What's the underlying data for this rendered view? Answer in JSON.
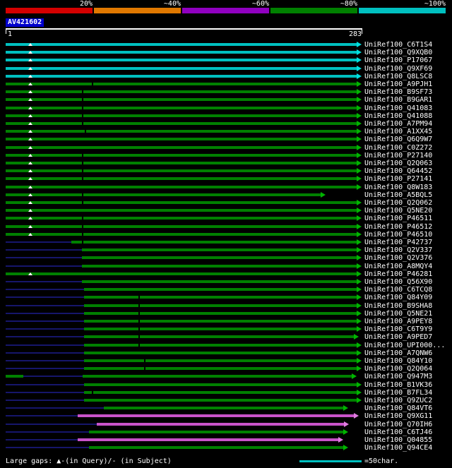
{
  "scale": {
    "segments": [
      {
        "label": "20%",
        "color": "#d40000"
      },
      {
        "label": "~40%",
        "color": "#e07800"
      },
      {
        "label": "~60%",
        "color": "#9000c0"
      },
      {
        "label": "~80%",
        "color": "#008000"
      },
      {
        "label": "~100%",
        "color": "#00c0c0"
      }
    ]
  },
  "query": {
    "name": "AV421602",
    "start_label": "1",
    "end_label": "283",
    "length": 283
  },
  "colors": {
    "cyan": "#00c0c0",
    "green": "#008000",
    "magenta": "#c853c8",
    "line": "#16166b",
    "arrow_cyan": "#00e0e0",
    "arrow_green": "#00b400",
    "arrow_magenta": "#e07ce0"
  },
  "rows": [
    {
      "label": "UniRef100_C6T1S4",
      "color": "cyan",
      "line": null,
      "bars": [
        [
          1,
          283
        ]
      ],
      "query_gaps": [
        21
      ],
      "subject_gaps": []
    },
    {
      "label": "UniRef100_Q9XQB0",
      "color": "cyan",
      "line": null,
      "bars": [
        [
          1,
          283
        ]
      ],
      "query_gaps": [
        21
      ],
      "subject_gaps": []
    },
    {
      "label": "UniRef100_P17067",
      "color": "cyan",
      "line": null,
      "bars": [
        [
          1,
          283
        ]
      ],
      "query_gaps": [
        21
      ],
      "subject_gaps": []
    },
    {
      "label": "UniRef100_Q9XF69",
      "color": "cyan",
      "line": null,
      "bars": [
        [
          1,
          283
        ]
      ],
      "query_gaps": [
        21
      ],
      "subject_gaps": []
    },
    {
      "label": "UniRef100_Q8LSC8",
      "color": "cyan",
      "line": null,
      "bars": [
        [
          1,
          283
        ]
      ],
      "query_gaps": [
        21
      ],
      "subject_gaps": []
    },
    {
      "label": "UniRef100_A9PJH1",
      "color": "green",
      "line": null,
      "bars": [
        [
          1,
          283
        ]
      ],
      "query_gaps": [
        21
      ],
      "subject_gaps": [
        71
      ]
    },
    {
      "label": "UniRef100_B9SF73",
      "color": "green",
      "line": null,
      "bars": [
        [
          1,
          283
        ]
      ],
      "query_gaps": [
        21
      ],
      "subject_gaps": [
        63
      ]
    },
    {
      "label": "UniRef100_B9GAR1",
      "color": "green",
      "line": null,
      "bars": [
        [
          1,
          283
        ]
      ],
      "query_gaps": [
        21
      ],
      "subject_gaps": [
        63
      ]
    },
    {
      "label": "UniRef100_Q41083",
      "color": "green",
      "line": null,
      "bars": [
        [
          1,
          283
        ]
      ],
      "query_gaps": [
        21
      ],
      "subject_gaps": [
        63
      ]
    },
    {
      "label": "UniRef100_Q41088",
      "color": "green",
      "line": null,
      "bars": [
        [
          1,
          283
        ]
      ],
      "query_gaps": [
        21
      ],
      "subject_gaps": [
        63
      ]
    },
    {
      "label": "UniRef100_A7PM94",
      "color": "green",
      "line": null,
      "bars": [
        [
          1,
          283
        ]
      ],
      "query_gaps": [
        21
      ],
      "subject_gaps": [
        63
      ]
    },
    {
      "label": "UniRef100_A1XX45",
      "color": "green",
      "line": null,
      "bars": [
        [
          1,
          283
        ]
      ],
      "query_gaps": [
        21
      ],
      "subject_gaps": [
        65
      ]
    },
    {
      "label": "UniRef100_Q6Q9W7",
      "color": "green",
      "line": null,
      "bars": [
        [
          1,
          283
        ]
      ],
      "query_gaps": [
        21
      ],
      "subject_gaps": []
    },
    {
      "label": "UniRef100_C0Z272",
      "color": "green",
      "line": null,
      "bars": [
        [
          1,
          283
        ]
      ],
      "query_gaps": [
        21
      ],
      "subject_gaps": []
    },
    {
      "label": "UniRef100_P27140",
      "color": "green",
      "line": null,
      "bars": [
        [
          1,
          283
        ]
      ],
      "query_gaps": [
        21
      ],
      "subject_gaps": [
        63
      ]
    },
    {
      "label": "UniRef100_Q2Q063",
      "color": "green",
      "line": null,
      "bars": [
        [
          1,
          283
        ]
      ],
      "query_gaps": [
        21
      ],
      "subject_gaps": [
        63
      ]
    },
    {
      "label": "UniRef100_Q64452",
      "color": "green",
      "line": null,
      "bars": [
        [
          1,
          283
        ]
      ],
      "query_gaps": [
        21
      ],
      "subject_gaps": [
        63
      ]
    },
    {
      "label": "UniRef100_P27141",
      "color": "green",
      "line": null,
      "bars": [
        [
          1,
          283
        ]
      ],
      "query_gaps": [
        21
      ],
      "subject_gaps": [
        63
      ]
    },
    {
      "label": "UniRef100_Q8W183",
      "color": "green",
      "line": null,
      "bars": [
        [
          1,
          283
        ]
      ],
      "query_gaps": [
        21
      ],
      "subject_gaps": []
    },
    {
      "label": "UniRef100_A5BQL5",
      "color": "green",
      "line": null,
      "bars": [
        [
          1,
          254
        ]
      ],
      "query_gaps": [
        21
      ],
      "subject_gaps": [
        63
      ]
    },
    {
      "label": "UniRef100_Q2Q062",
      "color": "green",
      "line": null,
      "bars": [
        [
          1,
          283
        ]
      ],
      "query_gaps": [
        21
      ],
      "subject_gaps": [
        63
      ]
    },
    {
      "label": "UniRef100_Q5NE20",
      "color": "green",
      "line": null,
      "bars": [
        [
          1,
          283
        ]
      ],
      "query_gaps": [
        21
      ],
      "subject_gaps": []
    },
    {
      "label": "UniRef100_P46511",
      "color": "green",
      "line": null,
      "bars": [
        [
          1,
          283
        ]
      ],
      "query_gaps": [
        21
      ],
      "subject_gaps": [
        63
      ]
    },
    {
      "label": "UniRef100_P46512",
      "color": "green",
      "line": null,
      "bars": [
        [
          1,
          283
        ]
      ],
      "query_gaps": [
        21
      ],
      "subject_gaps": [
        63
      ]
    },
    {
      "label": "UniRef100_P46510",
      "color": "green",
      "line": null,
      "bars": [
        [
          1,
          283
        ]
      ],
      "query_gaps": [
        21
      ],
      "subject_gaps": [
        63
      ]
    },
    {
      "label": "UniRef100_P42737",
      "color": "green",
      "line": [
        1,
        54
      ],
      "bars": [
        [
          54,
          283
        ]
      ],
      "query_gaps": [],
      "subject_gaps": [
        63
      ]
    },
    {
      "label": "UniRef100_Q2V337",
      "color": "green",
      "line": [
        1,
        62
      ],
      "bars": [
        [
          62,
          283
        ]
      ],
      "query_gaps": [],
      "subject_gaps": []
    },
    {
      "label": "UniRef100_Q2V376",
      "color": "green",
      "line": [
        1,
        62
      ],
      "bars": [
        [
          62,
          283
        ]
      ],
      "query_gaps": [],
      "subject_gaps": []
    },
    {
      "label": "UniRef100_A8MQY4",
      "color": "green",
      "line": [
        1,
        62
      ],
      "bars": [
        [
          62,
          283
        ]
      ],
      "query_gaps": [],
      "subject_gaps": []
    },
    {
      "label": "UniRef100_P46281",
      "color": "green",
      "line": null,
      "bars": [
        [
          1,
          283
        ]
      ],
      "query_gaps": [
        21
      ],
      "subject_gaps": []
    },
    {
      "label": "UniRef100_Q56X90",
      "color": "green",
      "line": [
        1,
        62
      ],
      "bars": [
        [
          62,
          283
        ]
      ],
      "query_gaps": [],
      "subject_gaps": []
    },
    {
      "label": "UniRef100_C6TCQ8",
      "color": "green",
      "line": [
        1,
        64
      ],
      "bars": [
        [
          64,
          283
        ]
      ],
      "query_gaps": [],
      "subject_gaps": []
    },
    {
      "label": "UniRef100_Q84Y09",
      "color": "green",
      "line": [
        1,
        64
      ],
      "bars": [
        [
          64,
          283
        ]
      ],
      "query_gaps": [],
      "subject_gaps": [
        108
      ]
    },
    {
      "label": "UniRef100_B9SHA8",
      "color": "green",
      "line": [
        1,
        64
      ],
      "bars": [
        [
          64,
          283
        ]
      ],
      "query_gaps": [],
      "subject_gaps": [
        108
      ]
    },
    {
      "label": "UniRef100_Q5NE21",
      "color": "green",
      "line": [
        1,
        64
      ],
      "bars": [
        [
          64,
          283
        ]
      ],
      "query_gaps": [],
      "subject_gaps": [
        108
      ]
    },
    {
      "label": "UniRef100_A9PEY8",
      "color": "green",
      "line": [
        1,
        64
      ],
      "bars": [
        [
          64,
          283
        ]
      ],
      "query_gaps": [],
      "subject_gaps": [
        108
      ]
    },
    {
      "label": "UniRef100_C6T9Y9",
      "color": "green",
      "line": [
        1,
        64
      ],
      "bars": [
        [
          64,
          283
        ]
      ],
      "query_gaps": [],
      "subject_gaps": [
        108
      ]
    },
    {
      "label": "UniRef100_A9PED7",
      "color": "green",
      "line": [
        1,
        64
      ],
      "bars": [
        [
          64,
          281
        ]
      ],
      "query_gaps": [],
      "subject_gaps": [
        108
      ]
    },
    {
      "label": "UniRef100_UPI000...",
      "color": "green",
      "line": [
        1,
        64
      ],
      "bars": [
        [
          64,
          283
        ]
      ],
      "query_gaps": [],
      "subject_gaps": [
        108
      ]
    },
    {
      "label": "UniRef100_A7QNW6",
      "color": "green",
      "line": [
        1,
        64
      ],
      "bars": [
        [
          64,
          283
        ]
      ],
      "query_gaps": [],
      "subject_gaps": []
    },
    {
      "label": "UniRef100_Q84Y10",
      "color": "green",
      "line": [
        1,
        64
      ],
      "bars": [
        [
          64,
          283
        ]
      ],
      "query_gaps": [],
      "subject_gaps": [
        113
      ]
    },
    {
      "label": "UniRef100_Q2Q064",
      "color": "green",
      "line": [
        1,
        64
      ],
      "bars": [
        [
          64,
          283
        ]
      ],
      "query_gaps": [],
      "subject_gaps": [
        113
      ]
    },
    {
      "label": "UniRef100_Q947M3",
      "color": "green",
      "line": [
        15,
        63
      ],
      "bars": [
        [
          1,
          15
        ],
        [
          63,
          279
        ]
      ],
      "query_gaps": [],
      "subject_gaps": []
    },
    {
      "label": "UniRef100_B1VK36",
      "color": "green",
      "line": [
        1,
        64
      ],
      "bars": [
        [
          64,
          283
        ]
      ],
      "query_gaps": [],
      "subject_gaps": []
    },
    {
      "label": "UniRef100_B7FL34",
      "color": "green",
      "line": [
        1,
        64
      ],
      "bars": [
        [
          64,
          283
        ]
      ],
      "query_gaps": [],
      "subject_gaps": [
        71
      ]
    },
    {
      "label": "UniRef100_Q9ZUC2",
      "color": "green",
      "line": [
        1,
        64
      ],
      "bars": [
        [
          64,
          283
        ]
      ],
      "query_gaps": [],
      "subject_gaps": []
    },
    {
      "label": "UniRef100_Q84VT6",
      "color": "green",
      "line": [
        1,
        80
      ],
      "bars": [
        [
          80,
          272
        ]
      ],
      "query_gaps": [],
      "subject_gaps": []
    },
    {
      "label": "UniRef100_Q9XG11",
      "color": "magenta",
      "line": [
        1,
        59
      ],
      "bars": [
        [
          59,
          281
        ]
      ],
      "query_gaps": [],
      "subject_gaps": []
    },
    {
      "label": "UniRef100_Q70IH6",
      "color": "magenta",
      "line": [
        1,
        74
      ],
      "bars": [
        [
          74,
          273
        ]
      ],
      "query_gaps": [],
      "subject_gaps": []
    },
    {
      "label": "UniRef100_C6TJ46",
      "color": "green",
      "line": [
        1,
        68
      ],
      "bars": [
        [
          68,
          272
        ]
      ],
      "query_gaps": [],
      "subject_gaps": []
    },
    {
      "label": "UniRef100_Q04855",
      "color": "magenta",
      "line": [
        1,
        59
      ],
      "bars": [
        [
          59,
          268
        ]
      ],
      "query_gaps": [],
      "subject_gaps": []
    },
    {
      "label": "UniRef100_Q94CE4",
      "color": "green",
      "line": [
        1,
        68
      ],
      "bars": [
        [
          68,
          272
        ]
      ],
      "query_gaps": [],
      "subject_gaps": []
    }
  ],
  "legend": {
    "gaps_text": "Large gaps: ▲-(in Query)/- (in Subject)",
    "scale_text": "=50char.",
    "scale_color": "#00c0c0"
  }
}
